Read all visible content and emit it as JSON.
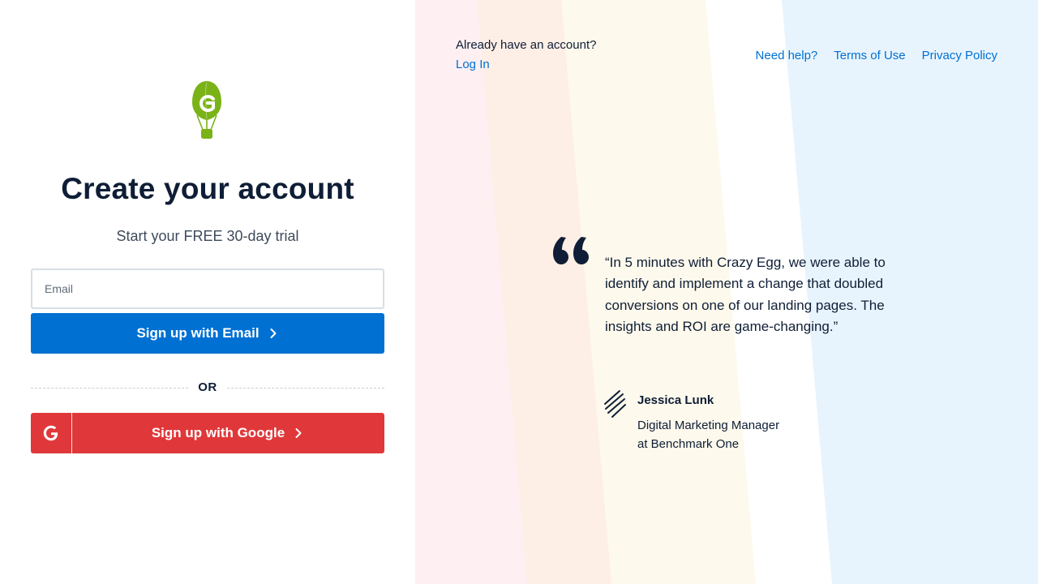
{
  "signup": {
    "title": "Create your account",
    "subtitle": "Start your FREE 30-day trial",
    "email_placeholder": "Email",
    "email_button_label": "Sign up with Email",
    "or_label": "OR",
    "google_button_label": "Sign up with Google"
  },
  "header": {
    "already_text": "Already have an account?",
    "login_label": "Log In",
    "links": [
      "Need help?",
      "Terms of Use",
      "Privacy Policy"
    ]
  },
  "testimonial": {
    "quote": "“In 5 minutes with Crazy Egg, we were able to identify and implement a change that doubled conversions on one of our landing pages. The insights and ROI are game-changing.”",
    "author_name": "Jessica Lunk",
    "author_title_line1": "Digital Marketing Manager",
    "author_title_line2": "at Benchmark One"
  },
  "colors": {
    "brand_green": "#7ab317",
    "primary_blue": "#0070d2",
    "google_red": "#e0383a",
    "text_dark": "#0f1e36",
    "stripe_pink": "#fdeff2",
    "stripe_peach": "#fdeee6",
    "stripe_cream": "#fdf9ec",
    "stripe_blue": "#e8f4fd"
  },
  "icons": {
    "logo": "crazy-egg-balloon-logo",
    "email_chevron": "chevron-right-icon",
    "google": "google-g-icon",
    "quote": "quote-mark-icon",
    "signature": "signature-icon"
  }
}
